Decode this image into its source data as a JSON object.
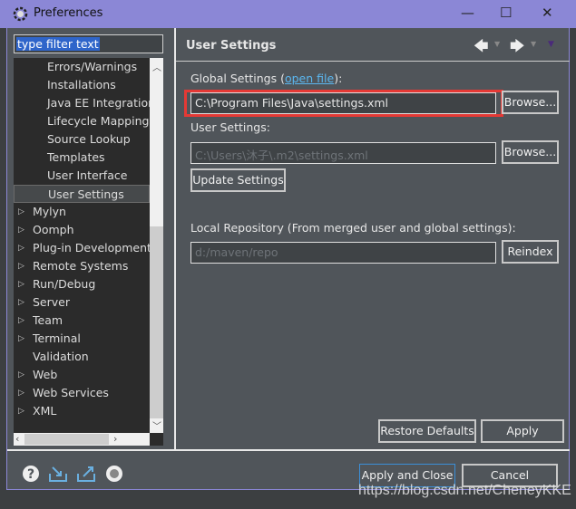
{
  "window": {
    "title": "Preferences",
    "minimize": "—",
    "maximize": "☐",
    "close": "✕"
  },
  "filter": {
    "placeholder": "type filter text"
  },
  "tree": {
    "items": [
      {
        "label": "Errors/Warnings",
        "indent": 2,
        "arrow": false
      },
      {
        "label": "Installations",
        "indent": 2,
        "arrow": false
      },
      {
        "label": "Java EE Integration",
        "indent": 2,
        "arrow": false
      },
      {
        "label": "Lifecycle Mappings",
        "indent": 2,
        "arrow": false
      },
      {
        "label": "Source Lookup",
        "indent": 2,
        "arrow": false
      },
      {
        "label": "Templates",
        "indent": 2,
        "arrow": false
      },
      {
        "label": "User Interface",
        "indent": 2,
        "arrow": false
      },
      {
        "label": "User Settings",
        "indent": 2,
        "arrow": false,
        "selected": true
      },
      {
        "label": "Mylyn",
        "indent": 1,
        "arrow": true
      },
      {
        "label": "Oomph",
        "indent": 1,
        "arrow": true
      },
      {
        "label": "Plug-in Development",
        "indent": 1,
        "arrow": true
      },
      {
        "label": "Remote Systems",
        "indent": 1,
        "arrow": true
      },
      {
        "label": "Run/Debug",
        "indent": 1,
        "arrow": true
      },
      {
        "label": "Server",
        "indent": 1,
        "arrow": true
      },
      {
        "label": "Team",
        "indent": 1,
        "arrow": true
      },
      {
        "label": "Terminal",
        "indent": 1,
        "arrow": true
      },
      {
        "label": "Validation",
        "indent": 1,
        "arrow": false
      },
      {
        "label": "Web",
        "indent": 1,
        "arrow": true
      },
      {
        "label": "Web Services",
        "indent": 1,
        "arrow": true
      },
      {
        "label": "XML",
        "indent": 1,
        "arrow": true
      }
    ]
  },
  "page": {
    "title": "User Settings",
    "global_label_pre": "Global Settings (",
    "open_file": "open file",
    "global_label_post": "):",
    "global_value": "C:\\Program Files\\Java\\settings.xml",
    "user_label": "User Settings:",
    "user_placeholder": "C:\\Users\\沐子\\.m2\\settings.xml",
    "browse": "Browse...",
    "update": "Update Settings",
    "local_label": "Local Repository (From merged user and global settings):",
    "local_value": "d:/maven/repo",
    "reindex": "Reindex",
    "restore": "Restore Defaults",
    "apply": "Apply"
  },
  "footer": {
    "apply_close": "Apply and Close",
    "cancel": "Cancel"
  },
  "watermark": "https://blog.csdn.net/CheneyKKE",
  "colors": {
    "titlebar": "#8b87d6",
    "highlight": "#e53935",
    "link": "#5bb7f0"
  }
}
